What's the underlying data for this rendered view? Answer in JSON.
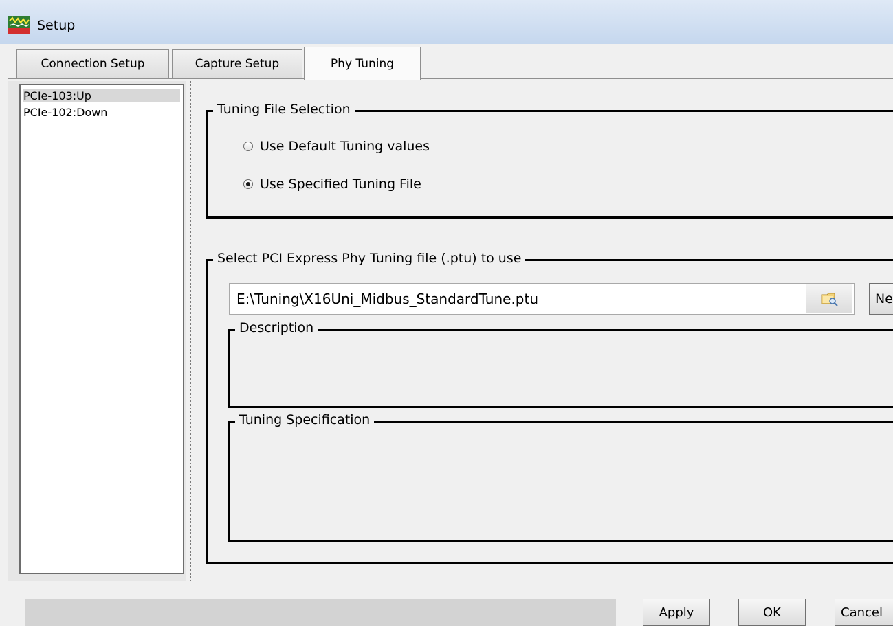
{
  "window": {
    "title": "Setup",
    "icon": "analyzer-app-icon"
  },
  "tabs": [
    {
      "label": "Connection Setup",
      "active": false
    },
    {
      "label": "Capture Setup",
      "active": false
    },
    {
      "label": "Phy Tuning",
      "active": true
    }
  ],
  "links": [
    {
      "label": "PCIe-103:Up",
      "selected": true
    },
    {
      "label": "PCIe-102:Down",
      "selected": false
    }
  ],
  "tuning_selection": {
    "legend": "Tuning File Selection",
    "options": [
      {
        "label": "Use Default Tuning values",
        "checked": false
      },
      {
        "label": "Use Specified Tuning File",
        "checked": true
      }
    ]
  },
  "file_group": {
    "legend": "Select PCI Express Phy Tuning file (.ptu) to use",
    "file_path": "E:\\Tuning\\X16Uni_Midbus_StandardTune.ptu",
    "browse_icon": "folder-search-icon",
    "new_label": "New",
    "description_legend": "Description",
    "specification_legend": "Tuning Specification"
  },
  "footer": {
    "apply_label": "Apply",
    "ok_label": "OK",
    "cancel_label": "Cancel"
  }
}
